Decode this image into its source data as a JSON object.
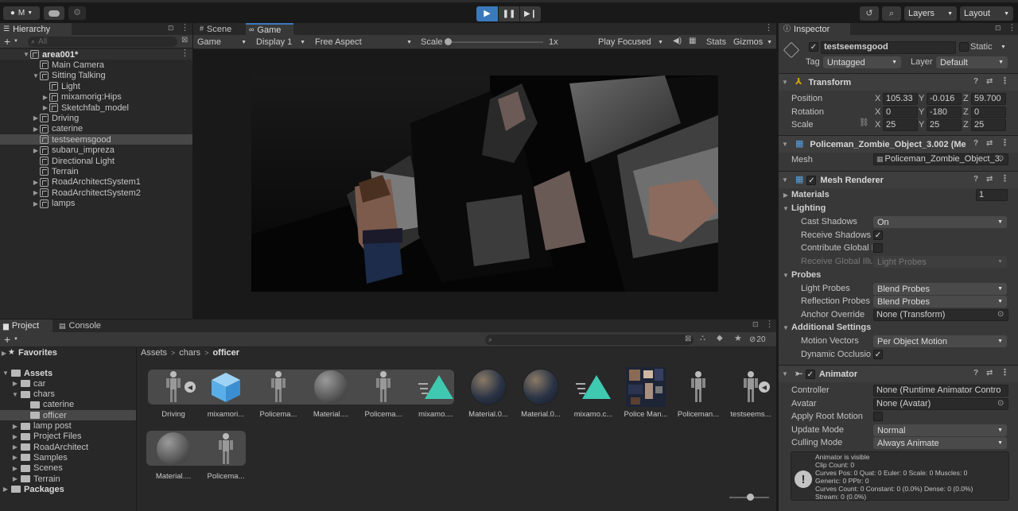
{
  "toolbar": {
    "account": "M",
    "layers": "Layers",
    "layout": "Layout"
  },
  "hierarchy": {
    "title": "Hierarchy",
    "search_placeholder": "All",
    "items": [
      {
        "label": "area001*",
        "indent": 0,
        "caret": "▼",
        "bold": true
      },
      {
        "label": "Main Camera",
        "indent": 1,
        "caret": ""
      },
      {
        "label": "Sitting Talking",
        "indent": 1,
        "caret": "▼"
      },
      {
        "label": "Light",
        "indent": 2,
        "caret": ""
      },
      {
        "label": "mixamorig:Hips",
        "indent": 2,
        "caret": "▶"
      },
      {
        "label": "Sketchfab_model",
        "indent": 2,
        "caret": "▶"
      },
      {
        "label": "Driving",
        "indent": 1,
        "caret": "▶"
      },
      {
        "label": "caterine",
        "indent": 1,
        "caret": "▶"
      },
      {
        "label": "testseemsgood",
        "indent": 1,
        "caret": "",
        "selected": true
      },
      {
        "label": "subaru_impreza",
        "indent": 1,
        "caret": "▶"
      },
      {
        "label": "Directional Light",
        "indent": 1,
        "caret": ""
      },
      {
        "label": "Terrain",
        "indent": 1,
        "caret": ""
      },
      {
        "label": "RoadArchitectSystem1",
        "indent": 1,
        "caret": "▶"
      },
      {
        "label": "RoadArchitectSystem2",
        "indent": 1,
        "caret": "▶"
      },
      {
        "label": "lamps",
        "indent": 1,
        "caret": "▶"
      }
    ]
  },
  "game": {
    "tab_scene": "Scene",
    "tab_game": "Game",
    "view": "Game",
    "display": "Display 1",
    "aspect": "Free Aspect",
    "scale_label": "Scale",
    "scale_value": "1x",
    "play_mode": "Play Focused",
    "stats": "Stats",
    "gizmos": "Gizmos"
  },
  "project": {
    "tab_project": "Project",
    "tab_console": "Console",
    "favorites": "Favorites",
    "hidden_count": "20",
    "breadcrumb": [
      "Assets",
      "chars",
      "officer"
    ],
    "tree": [
      {
        "label": "Assets",
        "indent": 0,
        "caret": "▼"
      },
      {
        "label": "car",
        "indent": 1,
        "caret": "▶"
      },
      {
        "label": "chars",
        "indent": 1,
        "caret": "▼"
      },
      {
        "label": "caterine",
        "indent": 2,
        "caret": ""
      },
      {
        "label": "officer",
        "indent": 2,
        "caret": "",
        "selected": true
      },
      {
        "label": "lamp post",
        "indent": 1,
        "caret": "▶"
      },
      {
        "label": "Project Files",
        "indent": 1,
        "caret": "▶"
      },
      {
        "label": "RoadArchitect",
        "indent": 1,
        "caret": "▶"
      },
      {
        "label": "Samples",
        "indent": 1,
        "caret": "▶"
      },
      {
        "label": "Scenes",
        "indent": 1,
        "caret": "▶"
      },
      {
        "label": "Terrain",
        "indent": 1,
        "caret": "▶"
      },
      {
        "label": "Packages",
        "indent": 0,
        "caret": "▶"
      }
    ],
    "assets": [
      {
        "name": "Driving",
        "kind": "figure"
      },
      {
        "name": "mixamori...",
        "kind": "prefab"
      },
      {
        "name": "Policema...",
        "kind": "figure"
      },
      {
        "name": "Material....",
        "kind": "sphere"
      },
      {
        "name": "Policema...",
        "kind": "figure"
      },
      {
        "name": "mixamo....",
        "kind": "anim"
      },
      {
        "name": "Material.0...",
        "kind": "texsphere"
      },
      {
        "name": "Material.0...",
        "kind": "texsphere"
      },
      {
        "name": "mixamo.c...",
        "kind": "anim"
      },
      {
        "name": "Police Man...",
        "kind": "texture"
      },
      {
        "name": "Policeman...",
        "kind": "figure"
      },
      {
        "name": "testseems...",
        "kind": "figure"
      },
      {
        "name": "Material....",
        "kind": "sphere"
      },
      {
        "name": "Policema...",
        "kind": "figure"
      }
    ]
  },
  "inspector": {
    "title": "Inspector",
    "object_name": "testseemsgood",
    "static_label": "Static",
    "tag_label": "Tag",
    "tag_value": "Untagged",
    "layer_label": "Layer",
    "layer_value": "Default",
    "transform": {
      "title": "Transform",
      "position_label": "Position",
      "rotation_label": "Rotation",
      "scale_label": "Scale",
      "position": {
        "x": "105.33",
        "y": "-0.016",
        "z": "59.700"
      },
      "rotation": {
        "x": "0",
        "y": "-180",
        "z": "0"
      },
      "scale": {
        "x": "25",
        "y": "25",
        "z": "25"
      }
    },
    "meshfilter": {
      "title": "Policeman_Zombie_Object_3.002 (Me",
      "mesh_label": "Mesh",
      "mesh_value": "Policeman_Zombie_Object_3."
    },
    "meshrenderer": {
      "title": "Mesh Renderer",
      "materials_label": "Materials",
      "materials_count": "1",
      "lighting_label": "Lighting",
      "cast_shadows_label": "Cast Shadows",
      "cast_shadows_value": "On",
      "receive_shadows_label": "Receive Shadows",
      "contribute_gi_label": "Contribute Global I",
      "receive_gi_label": "Receive Global Illu",
      "receive_gi_value": "Light Probes",
      "probes_label": "Probes",
      "light_probes_label": "Light Probes",
      "light_probes_value": "Blend Probes",
      "reflection_probes_label": "Reflection Probes",
      "reflection_probes_value": "Blend Probes",
      "anchor_label": "Anchor Override",
      "anchor_value": "None (Transform)",
      "additional_label": "Additional Settings",
      "motion_vectors_label": "Motion Vectors",
      "motion_vectors_value": "Per Object Motion",
      "dynamic_occlusion_label": "Dynamic Occlusio"
    },
    "animator": {
      "title": "Animator",
      "controller_label": "Controller",
      "controller_value": "None (Runtime Animator Contro",
      "avatar_label": "Avatar",
      "avatar_value": "None (Avatar)",
      "root_motion_label": "Apply Root Motion",
      "update_mode_label": "Update Mode",
      "update_mode_value": "Normal",
      "culling_label": "Culling Mode",
      "culling_value": "Always Animate",
      "info": [
        "Animator is visible",
        "Clip Count: 0",
        "Curves Pos: 0 Quat: 0 Euler: 0 Scale: 0 Muscles: 0",
        "Generic: 0 PPtr: 0",
        "Curves Count: 0 Constant: 0 (0.0%) Dense: 0 (0.0%)",
        "Stream: 0 (0.0%)"
      ]
    }
  },
  "colors": {
    "selection": "#2c5d87",
    "panel": "#383838",
    "accent": "#3a79bb"
  }
}
